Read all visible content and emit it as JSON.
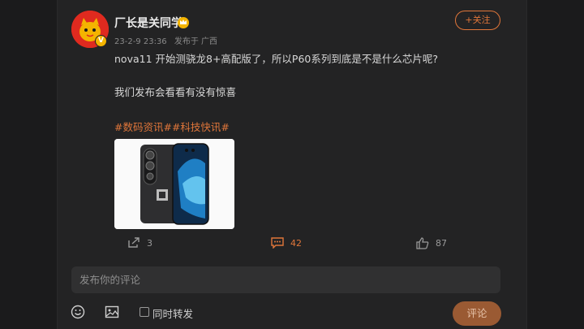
{
  "post": {
    "username": "厂长是关同学",
    "verified_badge": "V",
    "timestamp": "23-2-9 23:36",
    "source": "发布于 广西",
    "follow_label": "+关注",
    "text_line1": "nova11 开始测骁龙8+高配版了，所以P60系列到底是不是什么芯片呢?",
    "text_line2": "我们发布会看看有没有惊喜",
    "tags": [
      "#数码资讯#",
      "#科技快讯#"
    ],
    "image_alt": "phone-product-image"
  },
  "actions": {
    "repost_count": "3",
    "comment_count": "42",
    "like_count": "87"
  },
  "composer": {
    "placeholder": "发布你的评论",
    "repost_label": "同时转发",
    "submit_label": "评论"
  },
  "colors": {
    "accent": "#e0763a",
    "background": "#1b1b1c",
    "card": "#232324"
  },
  "icons": [
    "crown-icon",
    "share-icon",
    "comment-icon",
    "like-icon",
    "emoji-icon",
    "image-icon"
  ]
}
